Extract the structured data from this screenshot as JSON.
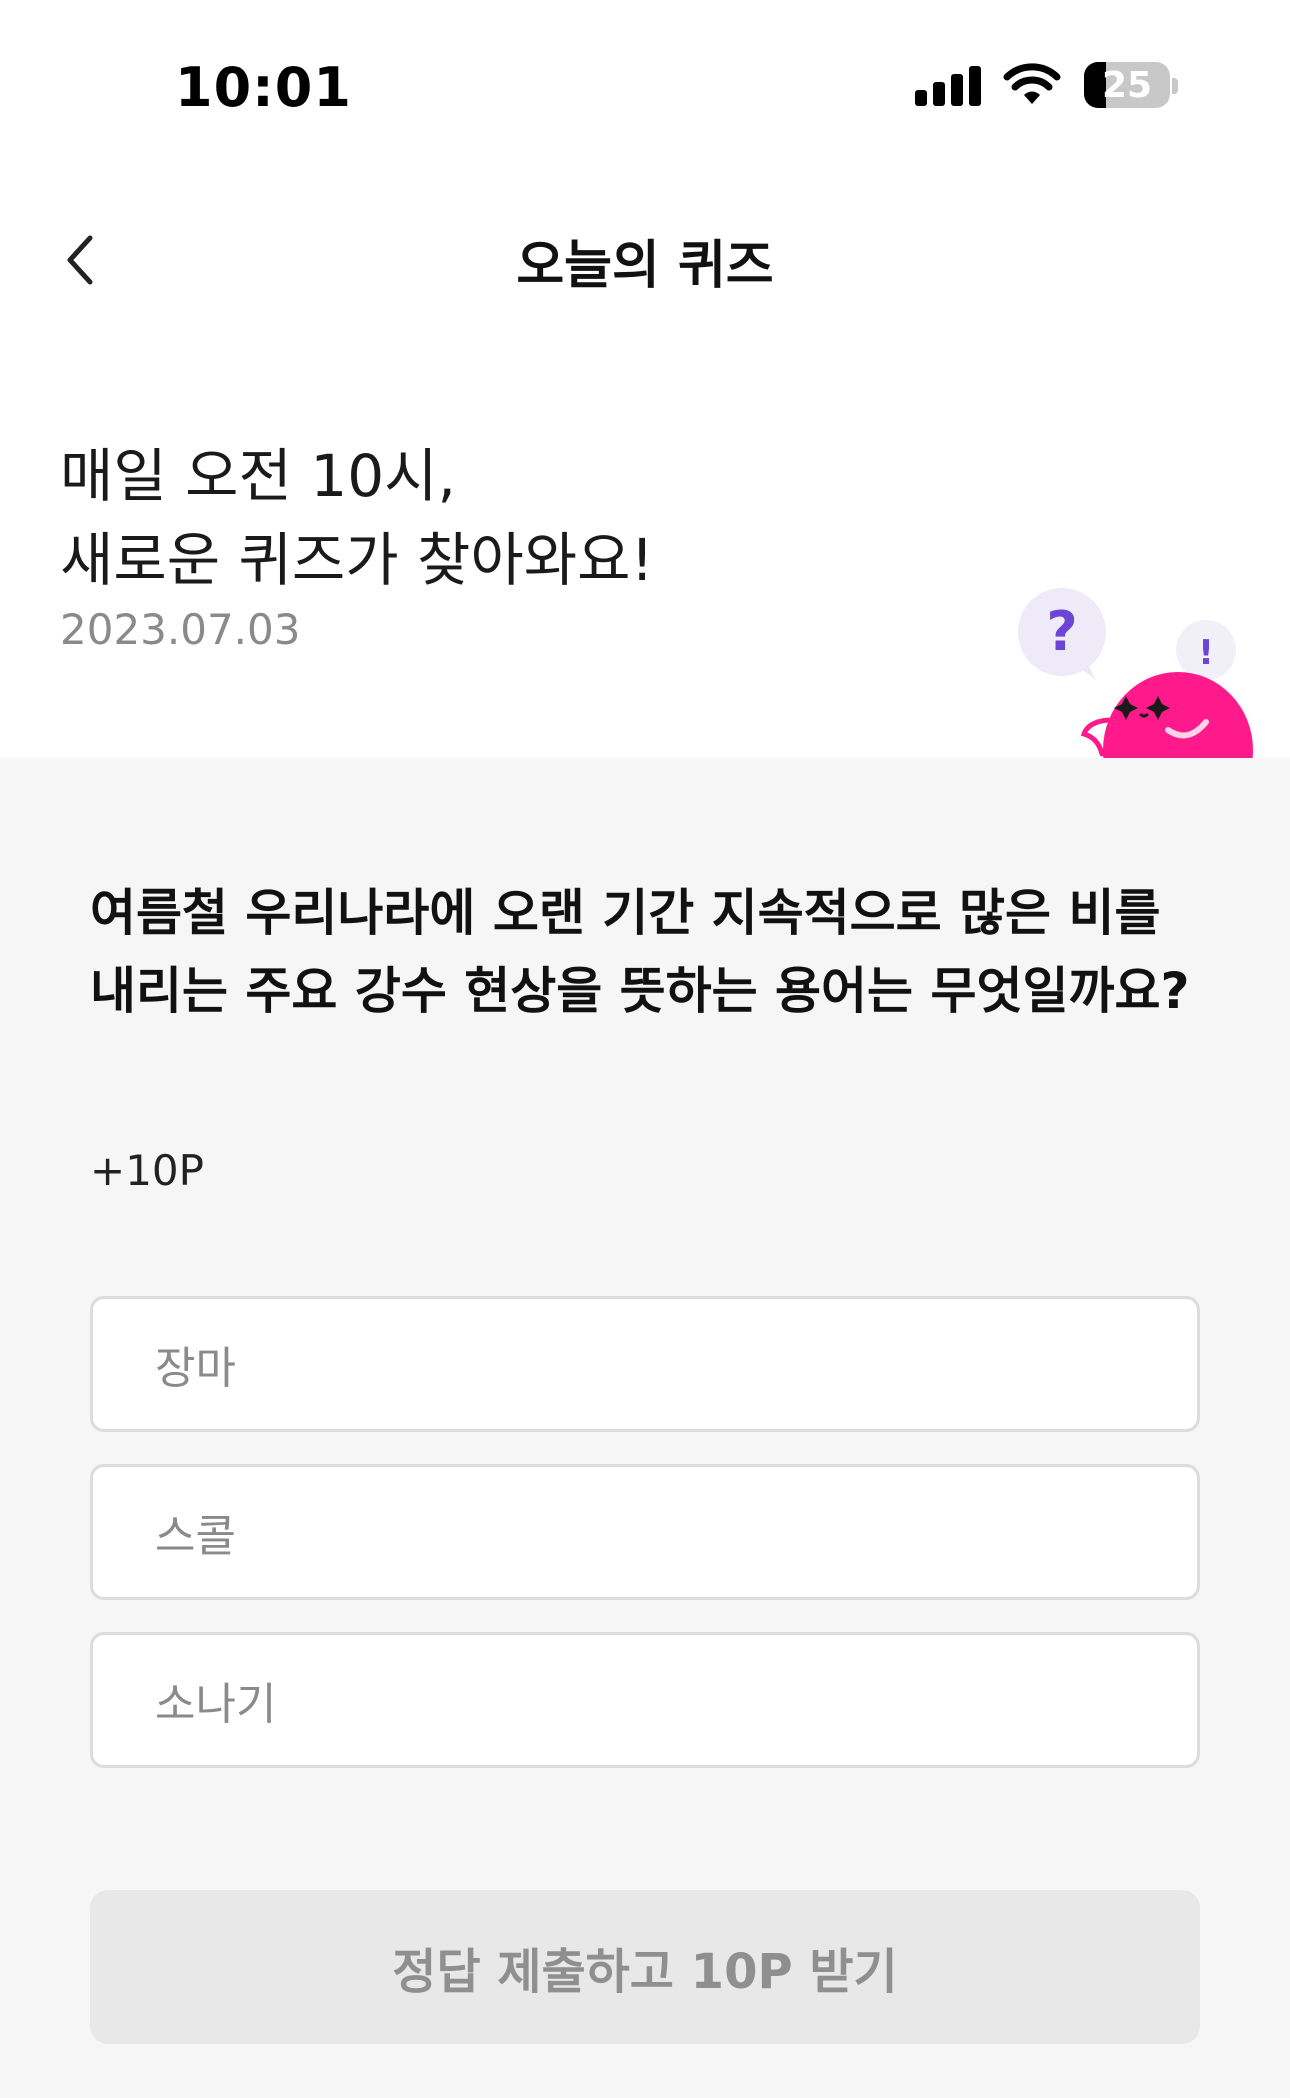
{
  "status_bar": {
    "time": "10:01",
    "battery_level": "25",
    "signal_icon": "cellular-signal-icon",
    "wifi_icon": "wifi-icon",
    "battery_icon": "battery-icon"
  },
  "header": {
    "title": "오늘의 퀴즈",
    "back_icon": "chevron-left-icon"
  },
  "intro": {
    "line1": "매일 오전 10시,",
    "line2": "새로운 퀴즈가 찾아와요!",
    "date": "2023.07.03"
  },
  "mascot": {
    "question_mark": "?",
    "exclamation_mark": "!",
    "color": "#ff1a8c"
  },
  "quiz": {
    "question": "여름철 우리나라에 오랜 기간 지속적으로 많은 비를 내리는 주요 강수 현상을 뜻하는 용어는 무엇일까요?",
    "reward": "+10P",
    "options": [
      "장마",
      "스콜",
      "소나기"
    ],
    "submit_label": "정답 제출하고 10P 받기"
  },
  "colors": {
    "accent": "#ff1a8c",
    "quiz_background": "#f6f6f6",
    "disabled_button": "#e8e8e8",
    "bubble_mark": "#6c45d6"
  }
}
